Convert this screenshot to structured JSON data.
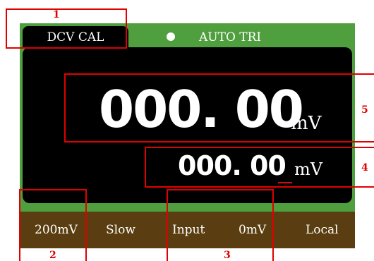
{
  "header": {
    "mode_tab": "DCV CAL",
    "status_indicator_icon": "dot-icon",
    "trigger_mode": "AUTO TRI"
  },
  "display": {
    "main_reading": "000. 00",
    "main_unit": "mV",
    "sub_reading": "000. 00",
    "sub_unit": "mV"
  },
  "softkeys": {
    "range": "200mV",
    "speed": "Slow",
    "input_label": "Input",
    "input_value": "0mV",
    "local": "Local"
  },
  "annotations": {
    "n1": "1",
    "n2": "2",
    "n3": "3",
    "n4": "4",
    "n5": "5"
  },
  "colors": {
    "frame_green": "#4f9f3f",
    "screen_black": "#000000",
    "softkey_bar_brown": "#5a3d10",
    "annotation_red": "#e00000",
    "cursor_red": "#d01010"
  }
}
